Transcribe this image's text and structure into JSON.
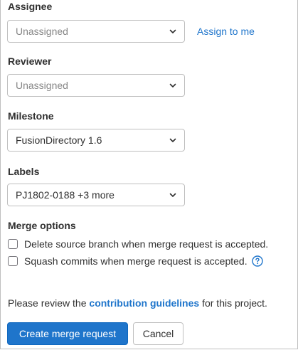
{
  "assignee": {
    "label": "Assignee",
    "value": "Unassigned",
    "assign_to_me": "Assign to me"
  },
  "reviewer": {
    "label": "Reviewer",
    "value": "Unassigned"
  },
  "milestone": {
    "label": "Milestone",
    "value": "FusionDirectory 1.6"
  },
  "labels": {
    "label": "Labels",
    "value": "PJ1802-0188 +3 more"
  },
  "merge_options": {
    "label": "Merge options",
    "delete_source_branch": "Delete source branch when merge request is accepted.",
    "squash_commits": "Squash commits when merge request is accepted."
  },
  "review_note": {
    "prefix": "Please review the ",
    "link": "contribution guidelines",
    "suffix": " for this project."
  },
  "actions": {
    "create": "Create merge request",
    "cancel": "Cancel"
  },
  "icons": {
    "dropdown": "chevron-down-icon",
    "help": "question-circle-icon"
  },
  "colors": {
    "link": "#1f75cb",
    "primary_button": "#1f75cb",
    "border": "#bfbfbf",
    "text": "#303030",
    "placeholder": "#868686"
  }
}
